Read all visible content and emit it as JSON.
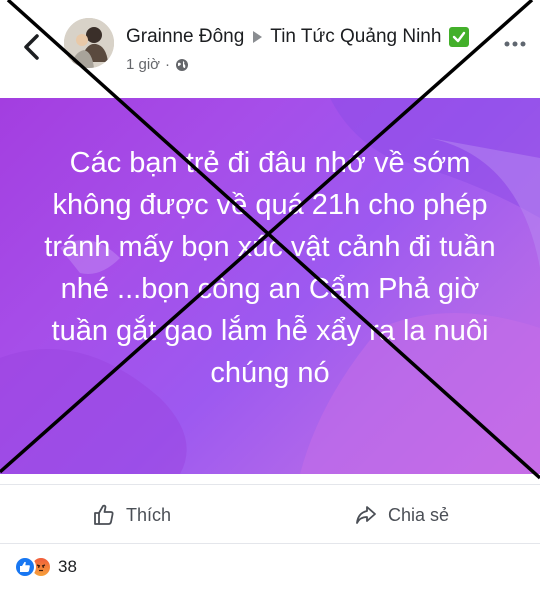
{
  "header": {
    "author": "Grainne Đông",
    "group": "Tin Tức Quảng Ninh",
    "time": "1 giờ",
    "meta_dot": "·"
  },
  "post": {
    "text": "Các bạn trẻ đi đâu nhớ về sớm không được về quá 21h cho phép tránh mấy bọn xúc vật cảnh đi tuần nhé ...bọn công an Cẩm Phả giờ tuần gắt gao lắm hễ xẩy ra la nuôi chúng nó"
  },
  "actions": {
    "like_label": "Thích",
    "share_label": "Chia sẻ"
  },
  "reactions": {
    "count": "38"
  },
  "icons": {
    "back": "chevron-left-icon",
    "globe": "globe-icon",
    "verified": "checkmark-icon",
    "more": "ellipsis-icon",
    "like": "thumbs-up-icon",
    "share": "share-arrow-icon"
  },
  "colors": {
    "post_bg_start": "#a33ee0",
    "post_bg_end": "#c86be6",
    "cross": "#000000",
    "check_badge": "#43b02a",
    "like_blue": "#1877f2"
  }
}
